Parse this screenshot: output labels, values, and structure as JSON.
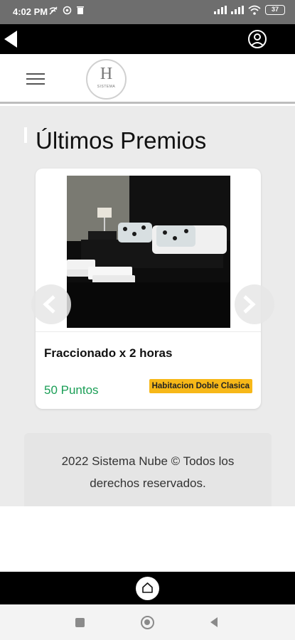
{
  "status_bar": {
    "time": "4:02 PM",
    "battery": "37",
    "icons": [
      "wifi-off-icon",
      "sync-icon",
      "trash-icon",
      "signal-icon",
      "signal-icon",
      "wifi-icon",
      "battery-icon"
    ]
  },
  "top_bar": {
    "icons": [
      "back-arrow-icon",
      "user-icon"
    ]
  },
  "header": {
    "logo_letter": "H",
    "logo_subtext": "SISTEMA",
    "icons": [
      "hamburger-menu-icon"
    ]
  },
  "section": {
    "title": "Últimos Premios"
  },
  "card": {
    "title": "Fraccionado x 2 horas",
    "points": "50 Puntos",
    "badge": "Habitacion Doble Clasica",
    "badge_color": "#f7b818",
    "points_color": "#1a9e56"
  },
  "carousel": {
    "icons": [
      "chevron-left-icon",
      "chevron-right-icon"
    ]
  },
  "footer": {
    "text": "2022 Sistema Nube © Todos los derechos reservados."
  },
  "bottom_bar": {
    "icons": [
      "home-icon"
    ]
  },
  "nav_bar": {
    "icons": [
      "recent-apps-icon",
      "home-nav-icon",
      "back-nav-icon"
    ]
  }
}
